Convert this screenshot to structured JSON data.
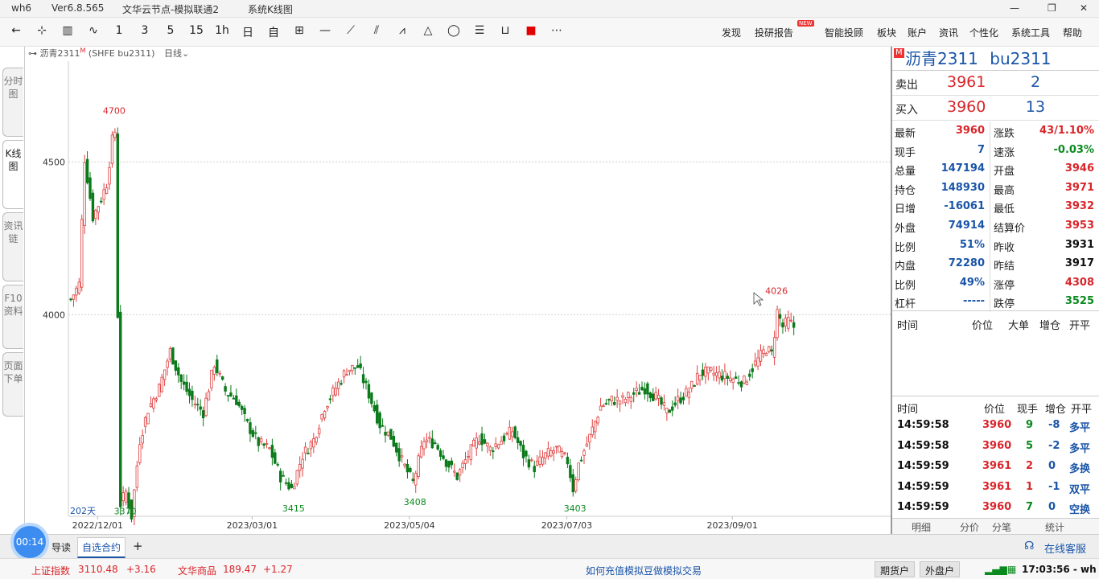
{
  "window": {
    "app": "wh6",
    "version": "Ver6.8.565",
    "node": "文华云节点-模拟联通2",
    "view": "系统K线图"
  },
  "toolbar": {
    "periods": [
      "1",
      "3",
      "5",
      "15",
      "1h",
      "日",
      "自"
    ],
    "menus": [
      "发现",
      "投研报告",
      "智能投顾",
      "板块",
      "账户",
      "资讯",
      "个性化",
      "系统工具",
      "帮助"
    ],
    "new_badge": "NEW"
  },
  "side_tabs": [
    "分时图",
    "K线图",
    "资讯链",
    "F10资料",
    "页面下单"
  ],
  "chart": {
    "header_symbol": "沥青2311",
    "header_badge": "M",
    "header_code": "(SHFE bu2311)",
    "header_period": "日线",
    "bar_count_label": "202天",
    "y_labels": [
      {
        "v": 4500,
        "t": "4500"
      },
      {
        "v": 4000,
        "t": "4000"
      }
    ],
    "x_labels": [
      {
        "i": 10,
        "t": "2022/12/01"
      },
      {
        "i": 66,
        "t": "2023/03/01"
      },
      {
        "i": 123,
        "t": "2023/05/04"
      },
      {
        "i": 180,
        "t": "2023/07/03"
      },
      {
        "i": 240,
        "t": "2023/09/01"
      }
    ],
    "annotations": [
      {
        "i": 16,
        "t": "4700",
        "c": "#d9252a",
        "pos": "above"
      },
      {
        "i": 20,
        "t": "3370",
        "c": "#0a8a1e",
        "pos": "below"
      },
      {
        "i": 81,
        "t": "3415",
        "c": "#0a8a1e",
        "pos": "below"
      },
      {
        "i": 125,
        "t": "3408",
        "c": "#0a8a1e",
        "pos": "below"
      },
      {
        "i": 183,
        "t": "3403",
        "c": "#0a8a1e",
        "pos": "below"
      },
      {
        "i": 256,
        "t": "4026",
        "c": "#d9252a",
        "pos": "above"
      }
    ]
  },
  "chart_data": {
    "type": "candlestick",
    "symbol": "沥青2311",
    "y_range": [
      3340,
      4830
    ],
    "anchors": [
      [
        0,
        4050
      ],
      [
        3,
        4100
      ],
      [
        5,
        4510
      ],
      [
        8,
        4320
      ],
      [
        11,
        4380
      ],
      [
        13,
        4430
      ],
      [
        15,
        4570
      ],
      [
        16,
        4600
      ],
      [
        17,
        4000
      ],
      [
        18,
        3380
      ],
      [
        20,
        3420
      ],
      [
        22,
        3340
      ],
      [
        25,
        3590
      ],
      [
        28,
        3690
      ],
      [
        32,
        3760
      ],
      [
        36,
        3880
      ],
      [
        40,
        3780
      ],
      [
        44,
        3720
      ],
      [
        48,
        3680
      ],
      [
        52,
        3840
      ],
      [
        56,
        3750
      ],
      [
        60,
        3720
      ],
      [
        64,
        3640
      ],
      [
        68,
        3580
      ],
      [
        72,
        3560
      ],
      [
        76,
        3470
      ],
      [
        80,
        3430
      ],
      [
        84,
        3540
      ],
      [
        88,
        3590
      ],
      [
        92,
        3700
      ],
      [
        96,
        3760
      ],
      [
        100,
        3820
      ],
      [
        104,
        3830
      ],
      [
        108,
        3740
      ],
      [
        112,
        3640
      ],
      [
        116,
        3600
      ],
      [
        120,
        3520
      ],
      [
        124,
        3450
      ],
      [
        128,
        3590
      ],
      [
        132,
        3580
      ],
      [
        136,
        3520
      ],
      [
        140,
        3470
      ],
      [
        144,
        3540
      ],
      [
        148,
        3600
      ],
      [
        152,
        3560
      ],
      [
        156,
        3590
      ],
      [
        160,
        3620
      ],
      [
        164,
        3540
      ],
      [
        168,
        3500
      ],
      [
        172,
        3540
      ],
      [
        176,
        3560
      ],
      [
        180,
        3520
      ],
      [
        182,
        3430
      ],
      [
        184,
        3510
      ],
      [
        188,
        3600
      ],
      [
        192,
        3700
      ],
      [
        196,
        3720
      ],
      [
        200,
        3720
      ],
      [
        204,
        3740
      ],
      [
        208,
        3760
      ],
      [
        212,
        3730
      ],
      [
        216,
        3680
      ],
      [
        220,
        3720
      ],
      [
        224,
        3750
      ],
      [
        228,
        3810
      ],
      [
        232,
        3810
      ],
      [
        236,
        3800
      ],
      [
        240,
        3790
      ],
      [
        244,
        3780
      ],
      [
        248,
        3840
      ],
      [
        252,
        3890
      ],
      [
        254,
        3870
      ],
      [
        256,
        4010
      ],
      [
        258,
        3960
      ],
      [
        260,
        3980
      ],
      [
        262,
        3960
      ]
    ]
  },
  "quote": {
    "badge": "M",
    "name": "沥青2311",
    "code": "bu2311",
    "ask_label": "卖出",
    "ask_price": "3961",
    "ask_vol": "2",
    "bid_label": "买入",
    "bid_price": "3960",
    "bid_vol": "13",
    "fields": [
      {
        "k": "最新",
        "v": "3960",
        "c": "red"
      },
      {
        "k": "涨跌",
        "v": "43/1.10%",
        "c": "red"
      },
      {
        "k": "现手",
        "v": "7",
        "c": "blue"
      },
      {
        "k": "速涨",
        "v": "-0.03%",
        "c": "green"
      },
      {
        "k": "总量",
        "v": "147194",
        "c": "blue"
      },
      {
        "k": "开盘",
        "v": "3946",
        "c": "red"
      },
      {
        "k": "持仓",
        "v": "148930",
        "c": "blue"
      },
      {
        "k": "最高",
        "v": "3971",
        "c": "red"
      },
      {
        "k": "日增",
        "v": "-16061",
        "c": "blue"
      },
      {
        "k": "最低",
        "v": "3932",
        "c": "red"
      },
      {
        "k": "外盘",
        "v": "74914",
        "c": "blue"
      },
      {
        "k": "结算价",
        "v": "3953",
        "c": "red"
      },
      {
        "k": "比例",
        "v": "51%",
        "c": "blue"
      },
      {
        "k": "昨收",
        "v": "3931",
        "c": "blk"
      },
      {
        "k": "内盘",
        "v": "72280",
        "c": "blue"
      },
      {
        "k": "昨结",
        "v": "3917",
        "c": "blk"
      },
      {
        "k": "比例",
        "v": "49%",
        "c": "blue"
      },
      {
        "k": "涨停",
        "v": "4308",
        "c": "red"
      },
      {
        "k": "杠杆",
        "v": "-----",
        "c": "blue"
      },
      {
        "k": "跌停",
        "v": "3525",
        "c": "green"
      }
    ],
    "big_order_headers": [
      "时间",
      "价位",
      "大单",
      "增仓",
      "开平"
    ],
    "tick_headers": [
      "时间",
      "价位",
      "现手",
      "增仓",
      "开平"
    ],
    "ticks": [
      {
        "time": "14:59:58",
        "price": "3960",
        "vol": "9",
        "chg": "-8",
        "type": "多平",
        "pc": "red",
        "vc": "green",
        "cc": "blue",
        "tc": "blue"
      },
      {
        "time": "14:59:58",
        "price": "3960",
        "vol": "5",
        "chg": "-2",
        "type": "多平",
        "pc": "red",
        "vc": "green",
        "cc": "blue",
        "tc": "blue"
      },
      {
        "time": "14:59:59",
        "price": "3961",
        "vol": "2",
        "chg": "0",
        "type": "多换",
        "pc": "red",
        "vc": "red",
        "cc": "blue",
        "tc": "blue"
      },
      {
        "time": "14:59:59",
        "price": "3961",
        "vol": "1",
        "chg": "-1",
        "type": "双平",
        "pc": "red",
        "vc": "red",
        "cc": "blue",
        "tc": "blue"
      },
      {
        "time": "14:59:59",
        "price": "3960",
        "vol": "7",
        "chg": "0",
        "type": "空换",
        "pc": "red",
        "vc": "green",
        "cc": "blue",
        "tc": "blue"
      }
    ],
    "bottom_tabs": [
      "明细",
      "分价",
      "分笔",
      "统计"
    ]
  },
  "tabs": {
    "clock": "00:14",
    "items": [
      "导读",
      "自选合约"
    ],
    "add": "+",
    "service": "在线客服"
  },
  "status": {
    "index1_name": "上证指数",
    "index1_val": "3110.48",
    "index1_chg": "+3.16",
    "index2_name": "文华商品",
    "index2_val": "189.47",
    "index2_chg": "+1.27",
    "notice": "如何充值模拟豆做模拟交易",
    "btn_futures": "期货户",
    "btn_outer": "外盘户",
    "time": "17:03:56 - wh"
  }
}
